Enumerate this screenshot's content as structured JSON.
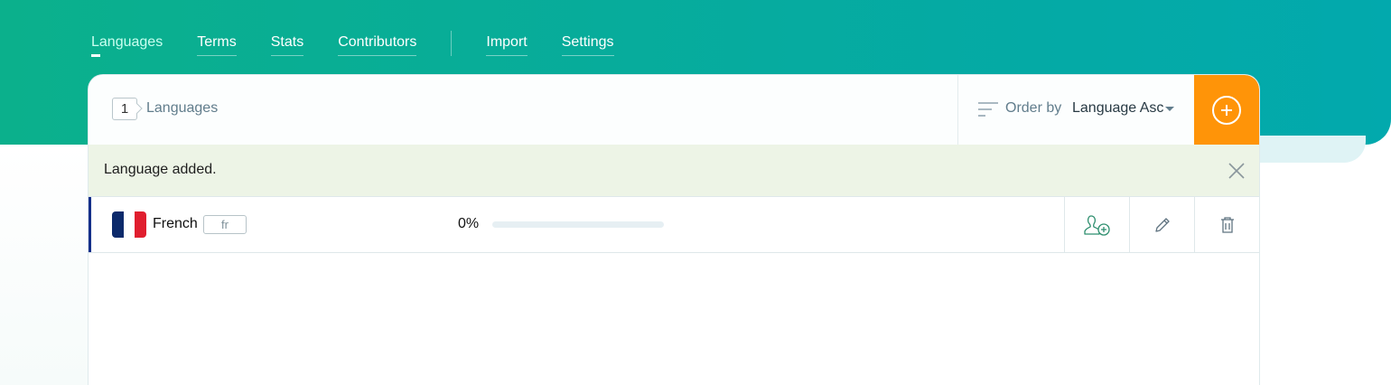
{
  "nav": {
    "items": [
      {
        "label": "Languages",
        "active": true
      },
      {
        "label": "Terms",
        "active": false
      },
      {
        "label": "Stats",
        "active": false
      },
      {
        "label": "Contributors",
        "active": false
      }
    ],
    "secondary": [
      {
        "label": "Import"
      },
      {
        "label": "Settings"
      }
    ]
  },
  "header": {
    "count": "1",
    "count_label": "Languages",
    "order_label": "Order by",
    "order_value": "Language Asc",
    "add_icon": "plus-circle-icon"
  },
  "alert": {
    "message": "Language added.",
    "close_icon": "close-icon"
  },
  "languages": [
    {
      "name": "French",
      "code": "fr",
      "flag_icon": "france-flag-icon",
      "progress_percent": 0,
      "progress_label": "0%"
    }
  ],
  "row_actions": [
    "add-contributor-icon",
    "pencil-icon",
    "trash-icon"
  ],
  "colors": {
    "brand_green": "#0bb08c",
    "brand_teal": "#02a9ad",
    "accent_orange": "#ff9408",
    "row_accent": "#142f8a",
    "alert_bg": "#edf4e6"
  }
}
